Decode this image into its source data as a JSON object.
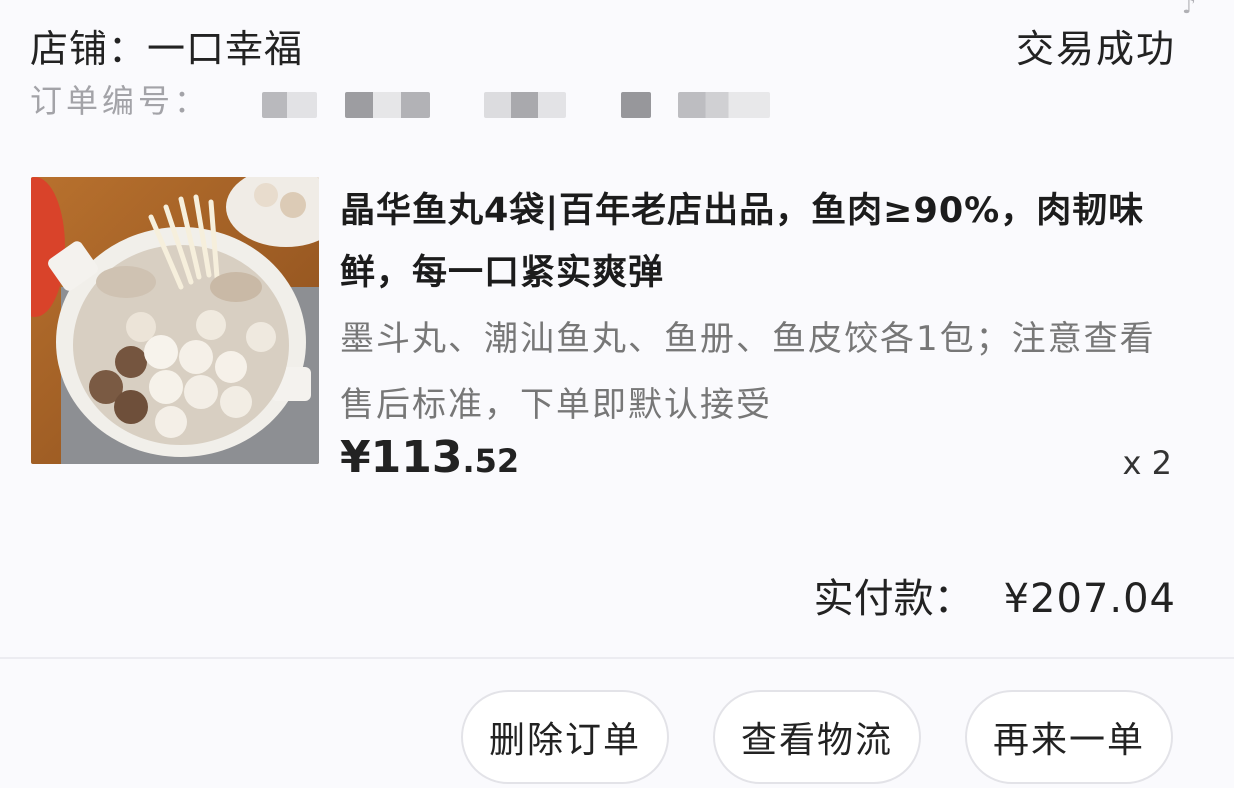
{
  "shop": {
    "label": "店铺：",
    "name": "一口幸福",
    "status": "交易成功"
  },
  "order": {
    "number_label": "订单编号："
  },
  "product": {
    "title": "晶华鱼丸4袋|百年老店出品，鱼肉≥90%，肉韧味鲜，每一口紧实爽弹",
    "subtitle": "墨斗丸、潮汕鱼丸、鱼册、鱼皮饺各1包；注意查看售后标准，下单即默认接受",
    "price_currency": "¥",
    "price_int": "113",
    "price_dec": ".52",
    "quantity": "x 2",
    "image_icon": "fishball-hotpot-image"
  },
  "payment": {
    "label": "实付款：",
    "amount": "¥207.04"
  },
  "actions": {
    "delete_label": "删除订单",
    "logistics_label": "查看物流",
    "reorder_label": "再来一单"
  },
  "colors": {
    "background": "#fafafd",
    "muted_text": "#a3a3a8",
    "secondary_text": "#777777",
    "button_border": "#e3e3e8"
  }
}
